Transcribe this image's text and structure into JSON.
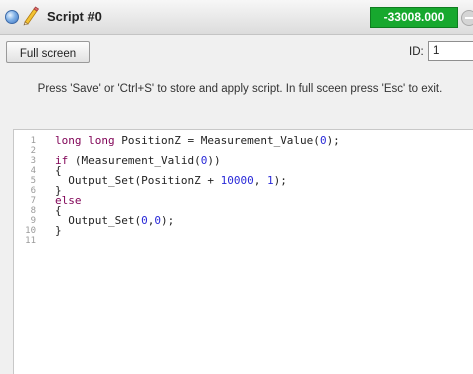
{
  "window": {
    "title": "Script #0",
    "value_badge": "-33008.000"
  },
  "toolbar": {
    "fullscreen_label": "Full screen",
    "id_label": "ID:",
    "id_value": "1"
  },
  "hint": "Press 'Save' or 'Ctrl+S' to store and apply script. In full sceen press 'Esc' to exit.",
  "editor": {
    "line_numbers": [
      "1",
      "2",
      "3",
      "4",
      "5",
      "6",
      "7",
      "8",
      "9",
      "10",
      "11"
    ],
    "lines": [
      "long long PositionZ = Measurement_Value(0);",
      "",
      "if (Measurement_Valid(0))",
      "{",
      "  Output_Set(PositionZ + 10000, 1);",
      "}",
      "else",
      "{",
      "  Output_Set(0,0);",
      "}",
      ""
    ]
  },
  "colors": {
    "badge_green": "#17a82e",
    "keyword": "#7f0055",
    "number": "#2a2ad8",
    "status_blue": "#3f74c2"
  },
  "icons": {
    "status": "status-dot-icon",
    "edit": "pencil-icon",
    "minimize": "minimize-icon"
  }
}
